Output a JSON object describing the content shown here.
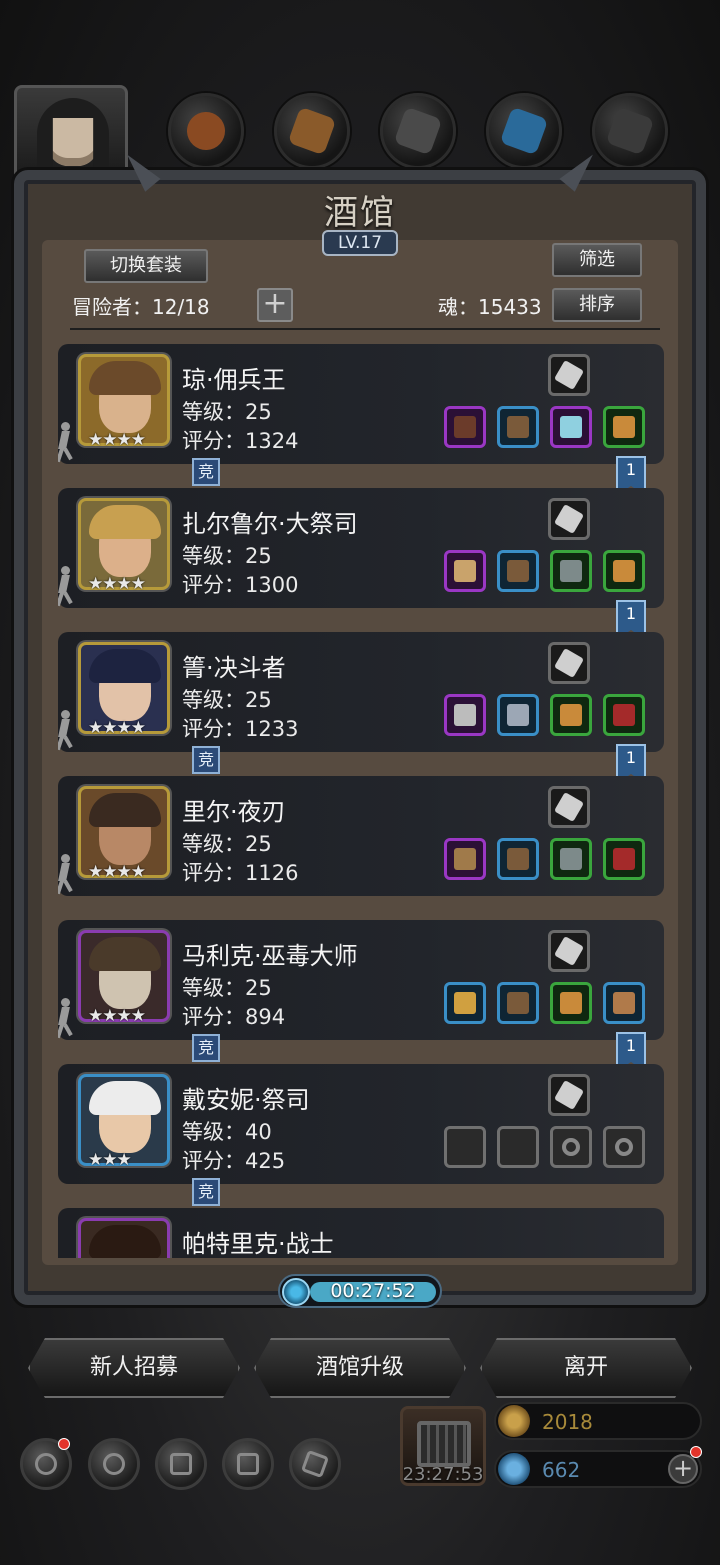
{
  "window": {
    "title": "酒馆",
    "level": "LV.17"
  },
  "header": {
    "switch_outfit_label": "切换套装",
    "filter_label": "筛选",
    "sort_label": "排序",
    "adventurers_text": "冒险者：12/18",
    "add_label": "+",
    "soul_text": "魂：15433"
  },
  "heroes": [
    {
      "name": "琼·佣兵王",
      "level": "等级：25",
      "score": "评分：1324",
      "stars": "★★★★",
      "frame": "#b69a3a",
      "bg": "#8c6a2a",
      "skin": "#d9b28c",
      "hair": "#6b4a2a",
      "tag": "竞",
      "ribbon": "1",
      "top_icon": "crystal-icon",
      "slots": [
        {
          "q": "purple",
          "icon": "rifle-icon",
          "c": "#6b3b2a"
        },
        {
          "q": "blue",
          "icon": "armor-icon",
          "c": "#7a5a3a"
        },
        {
          "q": "purple",
          "icon": "gem-icon",
          "c": "#8fd0e0"
        },
        {
          "q": "green",
          "icon": "chest-armor-icon",
          "c": "#c98a3a"
        }
      ]
    },
    {
      "name": "扎尔鲁尔·大祭司",
      "level": "等级：25",
      "score": "评分：1300",
      "stars": "★★★★",
      "frame": "#b69a3a",
      "bg": "#7a6a3a",
      "skin": "#dcb08a",
      "hair": "#c8a050",
      "tag": "",
      "ribbon": "1",
      "top_icon": "tablet-icon",
      "slots": [
        {
          "q": "purple",
          "icon": "hammer-icon",
          "c": "#c9a36b"
        },
        {
          "q": "blue",
          "icon": "armor-icon",
          "c": "#7a5a3a"
        },
        {
          "q": "green",
          "icon": "ring-icon",
          "c": "#7d8a8a"
        },
        {
          "q": "green",
          "icon": "chest-armor-icon",
          "c": "#c98a3a"
        }
      ]
    },
    {
      "name": "箐·决斗者",
      "level": "等级：25",
      "score": "评分：1233",
      "stars": "★★★★",
      "frame": "#b69a3a",
      "bg": "#2a3050",
      "skin": "#e2c2a8",
      "hair": "#1d2340",
      "tag": "竞",
      "ribbon": "1",
      "top_icon": "whip-icon",
      "slots": [
        {
          "q": "purple",
          "icon": "sword-icon",
          "c": "#bcbcbc"
        },
        {
          "q": "blue",
          "icon": "plate-armor-icon",
          "c": "#9ca7b5"
        },
        {
          "q": "green",
          "icon": "chest-armor-icon",
          "c": "#c98a3a"
        },
        {
          "q": "green",
          "icon": "amulet-icon",
          "c": "#a42a2a"
        }
      ]
    },
    {
      "name": "里尔·夜刃",
      "level": "等级：25",
      "score": "评分：1126",
      "stars": "★★★★",
      "frame": "#b69a3a",
      "bg": "#6a4a2a",
      "skin": "#b88866",
      "hair": "#3a2a20",
      "tag": "",
      "ribbon": "",
      "top_icon": "feather-icon",
      "slots": [
        {
          "q": "purple",
          "icon": "dagger-icon",
          "c": "#a07a4a"
        },
        {
          "q": "blue",
          "icon": "armor-icon",
          "c": "#7a5a3a"
        },
        {
          "q": "green",
          "icon": "ring-icon",
          "c": "#7d8a8a"
        },
        {
          "q": "green",
          "icon": "amulet-icon",
          "c": "#a42a2a"
        }
      ]
    },
    {
      "name": "马利克·巫毒大师",
      "level": "等级：25",
      "score": "评分：894",
      "stars": "★★★★",
      "frame": "#8a3cb0",
      "bg": "#3a2a2a",
      "skin": "#cfc3b0",
      "hair": "#4a3a2a",
      "tag": "竞",
      "ribbon": "1",
      "top_icon": "scroll-icon",
      "slots": [
        {
          "q": "blue",
          "icon": "staff-icon",
          "c": "#d0a040"
        },
        {
          "q": "blue",
          "icon": "armor-icon",
          "c": "#7a5a3a"
        },
        {
          "q": "green",
          "icon": "chest-armor-icon",
          "c": "#c98a3a"
        },
        {
          "q": "blue",
          "icon": "plank-icon",
          "c": "#b07a4a"
        }
      ]
    },
    {
      "name": "戴安妮·祭司",
      "level": "等级：40",
      "score": "评分：425",
      "stars": "★★★",
      "frame": "#3a8fc7",
      "bg": "#2a3a4a",
      "skin": "#e8c8a8",
      "hair": "#ececec",
      "tag": "竞",
      "ribbon": "",
      "top_icon": "rune-icon",
      "slots": [
        {
          "q": "empty-solid",
          "icon": "mace-icon",
          "c": "#9aa88a"
        },
        {
          "q": "empty-solid",
          "icon": "cloak-icon",
          "c": "#888"
        },
        {
          "q": "empty",
          "icon": "ring-icon",
          "c": ""
        },
        {
          "q": "empty",
          "icon": "ring-icon",
          "c": ""
        }
      ]
    },
    {
      "name": "帕特里克·战士",
      "level": "",
      "score": "",
      "stars": "",
      "frame": "#8a3cb0",
      "bg": "#3a2a22",
      "skin": "#c8a080",
      "hair": "#2a1a12",
      "tag": "",
      "ribbon": "",
      "top_icon": "",
      "slots": []
    }
  ],
  "timer": "00:27:52",
  "buttons": {
    "recruit": "新人招募",
    "upgrade": "酒馆升级",
    "leave": "离开"
  },
  "chest_timer": "23:27:53",
  "resources": {
    "gold": "2018",
    "gems": "662"
  },
  "colors": {
    "accent_blue": "#3a8fc7",
    "quality_purple": "#9a37c4",
    "quality_green": "#3aa63d",
    "gold_text": "#a88a3a",
    "gem_text": "#5a8ab0"
  }
}
